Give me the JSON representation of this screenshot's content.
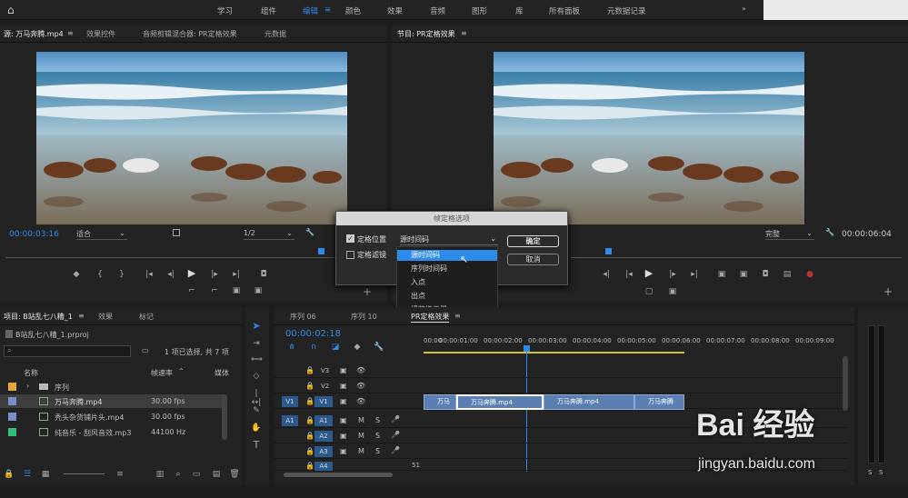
{
  "workspace_tabs": [
    "学习",
    "组件",
    "编辑",
    "颜色",
    "效果",
    "音频",
    "图形",
    "库",
    "所有面板",
    "元数据记录"
  ],
  "source_tabs": [
    "源: 万马奔腾.mp4",
    "效果控件",
    "音频剪辑混合器: PR定格效果",
    "元数据"
  ],
  "program_tab": "节目: PR定格效果",
  "source_timecode": "00:00:03:16",
  "source_fit": "适合",
  "source_res": "1/2",
  "program_quality": "完整",
  "program_timecode": "00:00:06:04",
  "dialog": {
    "title": "帧定格选项",
    "opt1": "定格位置",
    "opt2": "定格滤镜",
    "select": "源时间码",
    "ok": "确定",
    "cancel": "取消"
  },
  "menu_items": [
    "源时间码",
    "序列时间码",
    "入点",
    "出点",
    "播放指示器"
  ],
  "project": {
    "tab": "项目: B站乱七八糟_1",
    "tab2": "效果",
    "tab3": "标记",
    "file": "B站乱七八糟_1.prproj",
    "status": "1 项已选择, 共 7 项",
    "col_name": "名称",
    "col_rate": "帧速率",
    "col_media": "媒体",
    "items": [
      {
        "name": "序列",
        "rate": ""
      },
      {
        "name": "万马奔腾.mp4",
        "rate": "30.00 fps"
      },
      {
        "name": "秃头杂货铺片头.mp4",
        "rate": "30.00 fps"
      },
      {
        "name": "纯音乐 - 刮风音效.mp3",
        "rate": "44100 Hz"
      }
    ]
  },
  "timeline": {
    "tabs": [
      "序列 06",
      "序列 10",
      "PR定格效果"
    ],
    "timecode": "00:00:02:18",
    "ruler": [
      "00:00",
      "00:00:01:00",
      "00:00:02:00",
      "00:00:03:00",
      "00:00:04:00",
      "00:00:05:00",
      "00:00:06:00",
      "00:00:07:00",
      "00:00:08:00",
      "00:00:09:00"
    ],
    "video_tracks": [
      "V3",
      "V2",
      "V1"
    ],
    "audio_tracks": [
      "A1",
      "A2",
      "A3",
      "A4"
    ],
    "clips": [
      "万马",
      "万马奔腾.mp4",
      "万马奔腾.mp4",
      "万马奔腾"
    ],
    "a4_vol": "51"
  },
  "watermark": {
    "brand": "Bai 经验",
    "url": "jingyan.baidu.com"
  },
  "colors": {
    "accent": "#2d8ceb",
    "panel": "#232323",
    "clip": "#5b7fb3"
  }
}
